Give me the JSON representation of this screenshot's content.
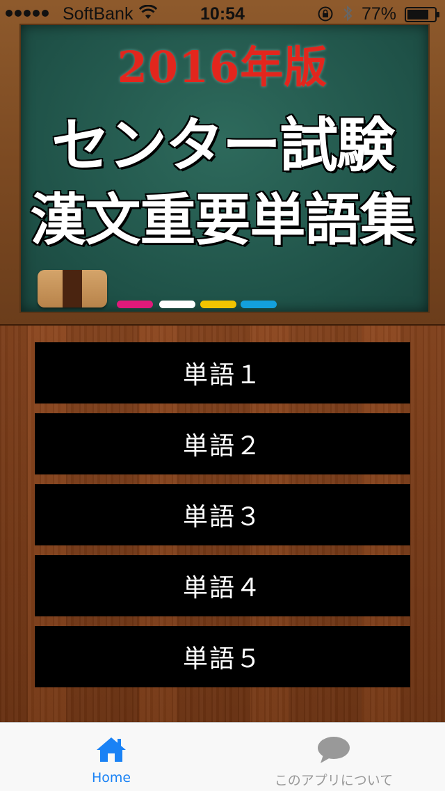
{
  "status_bar": {
    "carrier": "SoftBank",
    "time": "10:54",
    "battery": "77%"
  },
  "header": {
    "year_title": "2016年版",
    "title_line1": "センター試験",
    "title_line2": "漢文重要単語集"
  },
  "chalk_colors": [
    "#e0197a",
    "#ffffff",
    "#f2c400",
    "#13a0dc"
  ],
  "menu": {
    "items": [
      {
        "label": "単語１"
      },
      {
        "label": "単語２"
      },
      {
        "label": "単語３"
      },
      {
        "label": "単語４"
      },
      {
        "label": "単語５"
      }
    ]
  },
  "tab_bar": {
    "active_color": "#1a82f5",
    "inactive_color": "#999999",
    "tabs": [
      {
        "label": "Home",
        "icon": "home-icon",
        "active": true
      },
      {
        "label": "このアプリについて",
        "icon": "speech-bubble-icon",
        "active": false
      }
    ]
  }
}
